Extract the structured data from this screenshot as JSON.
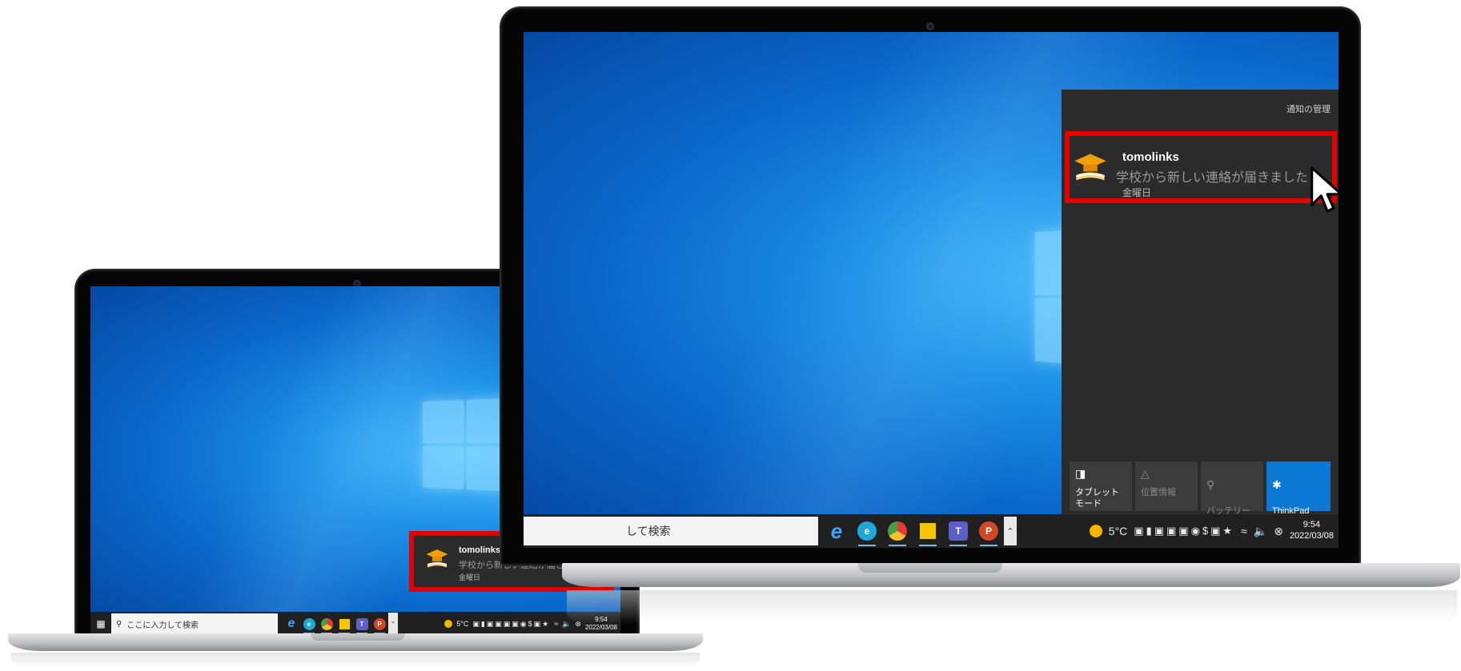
{
  "taskbar": {
    "search_placeholder": "ここに入力して検索",
    "search_placeholder_partial": "して検索",
    "weather": "5°C",
    "time": "9:54",
    "date": "2022/03/08"
  },
  "notification": {
    "app_name": "tomolinks",
    "message": "学校から新しい連絡が届きました",
    "day": "金曜日"
  },
  "action_center": {
    "manage_label": "通知の管理",
    "quick_actions": [
      {
        "label": "タブレット モード",
        "icon": "tablet-mode-icon"
      },
      {
        "label": "位置情報",
        "icon": "location-icon"
      },
      {
        "label": "バッテリー\n節約機能",
        "icon": "battery-saver-icon"
      },
      {
        "label": "ThinkPad\nBluetooth Laser",
        "icon": "bluetooth-icon"
      }
    ]
  },
  "colors": {
    "highlight_border": "#e30000",
    "taskbar": "#202020",
    "panel": "#2b2b2b",
    "accent": "#0a78d4"
  }
}
